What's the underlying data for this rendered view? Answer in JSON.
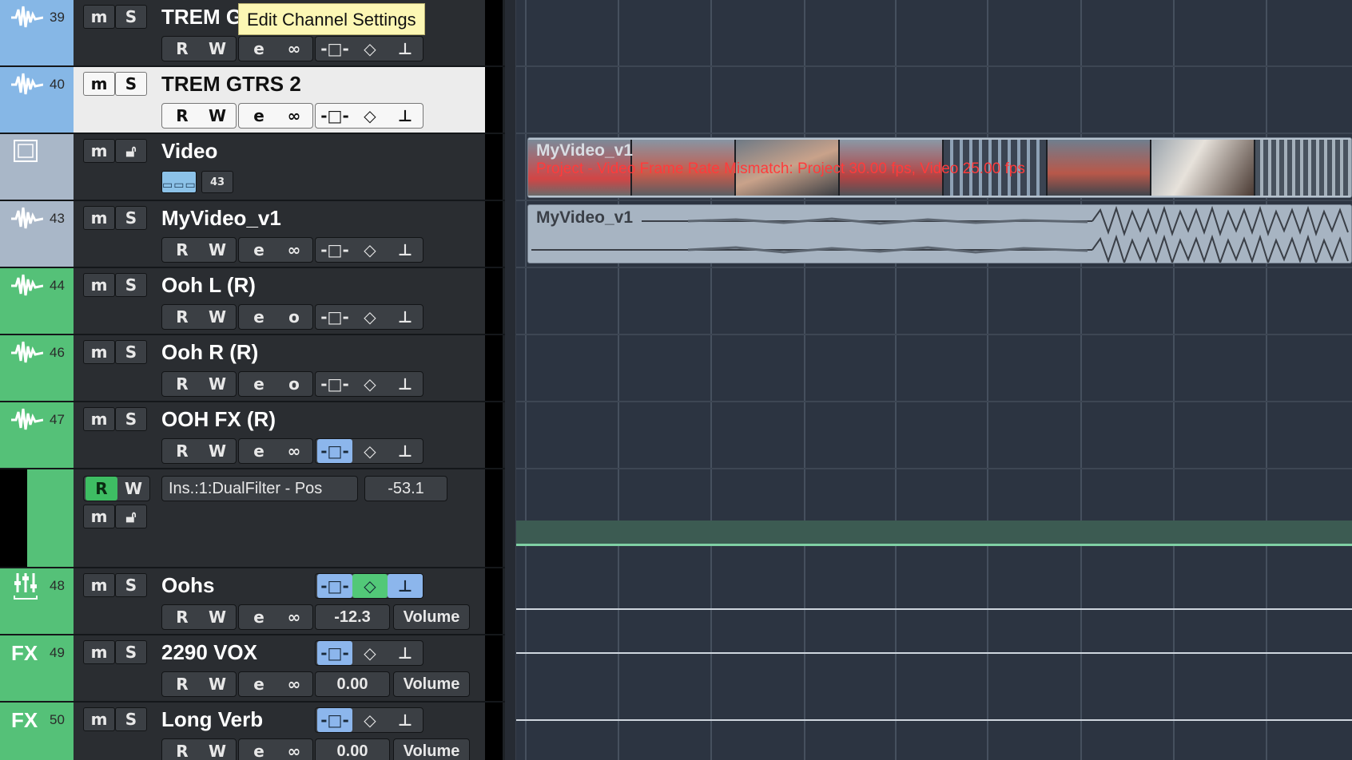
{
  "tooltip": "Edit Channel Settings",
  "colors": {
    "blue_track": "#86b7e6",
    "selected_track": "#86b7e6",
    "video_track": "#a9b7c8",
    "audio_track": "#a9b7c8",
    "green_track": "#55c178",
    "button_active_blue": "#8cb6ec",
    "button_active_green": "#52c878",
    "warning_red": "#ff3b3b"
  },
  "tracks": [
    {
      "number": "39",
      "name": "TREM GTRS 1",
      "icon": "waveform-icon",
      "mute": "m",
      "solo": "S",
      "read": "R",
      "write": "W",
      "edit": "e",
      "link": "∞"
    },
    {
      "number": "40",
      "name": "TREM GTRS 2",
      "icon": "waveform-icon",
      "mute": "m",
      "solo": "S",
      "read": "R",
      "write": "W",
      "edit": "e",
      "link": "∞"
    },
    {
      "number": "",
      "name": "Video",
      "icon": "film-icon",
      "mute": "m",
      "lock": "lock-icon"
    },
    {
      "number": "43",
      "name": "MyVideo_v1",
      "icon": "waveform-icon",
      "mute": "m",
      "solo": "S",
      "read": "R",
      "write": "W",
      "edit": "e",
      "link": "∞"
    },
    {
      "number": "44",
      "name": "Ooh L (R)",
      "icon": "waveform-icon",
      "mute": "m",
      "solo": "S",
      "read": "R",
      "write": "W",
      "edit": "e",
      "link": "o"
    },
    {
      "number": "46",
      "name": "Ooh R (R)",
      "icon": "waveform-icon",
      "mute": "m",
      "solo": "S",
      "read": "R",
      "write": "W",
      "edit": "e",
      "link": "o"
    },
    {
      "number": "47",
      "name": "OOH FX (R)",
      "icon": "waveform-icon",
      "mute": "m",
      "solo": "S",
      "read": "R",
      "write": "W",
      "edit": "e",
      "link": "∞"
    },
    {
      "number": "",
      "name": "",
      "automation_param": "Ins.:1:DualFilter - Pos",
      "automation_value": "-53.1",
      "read": "R",
      "write": "W",
      "mute": "m"
    },
    {
      "number": "48",
      "name": "Oohs",
      "icon": "group-fader-icon",
      "mute": "m",
      "solo": "S",
      "read": "R",
      "write": "W",
      "edit": "e",
      "link": "∞",
      "value": "-12.3",
      "param": "Volume"
    },
    {
      "number": "49",
      "name": "2290 VOX",
      "icon": "FX",
      "mute": "m",
      "solo": "S",
      "read": "R",
      "write": "W",
      "edit": "e",
      "link": "∞",
      "value": "0.00",
      "param": "Volume"
    },
    {
      "number": "50",
      "name": "Long Verb",
      "icon": "FX",
      "mute": "m",
      "solo": "S",
      "read": "R",
      "write": "W",
      "edit": "e",
      "link": "∞",
      "value": "0.00",
      "param": "Volume"
    }
  ],
  "events": {
    "video_title": "MyVideo_v1",
    "video_warning": "Project - Video Frame Rate Mismatch: Project 30.00 fps, Video 25.00 fps",
    "audio_title": "MyVideo_v1"
  },
  "video_track_controls": {
    "filmstrip_icon": "filmstrip-icon",
    "aspect_icon": "aspect-ratio-icon",
    "aspect_label": "43"
  }
}
